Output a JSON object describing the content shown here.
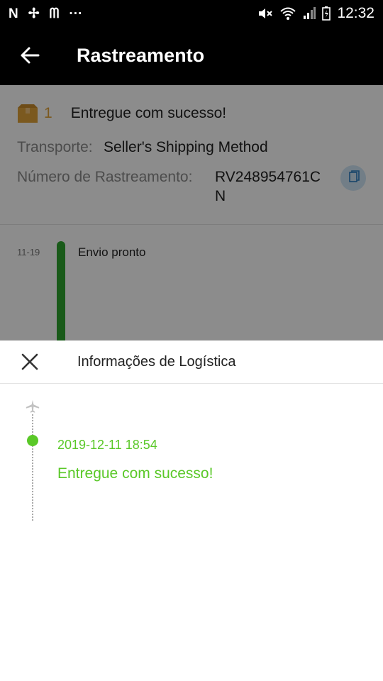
{
  "status_bar": {
    "left_icons": [
      "N",
      "✢",
      "ᗰ",
      "···"
    ],
    "time": "12:32"
  },
  "app_bar": {
    "title": "Rastreamento"
  },
  "order": {
    "count": "1",
    "status": "Entregue com sucesso!",
    "transport_label": "Transporte:",
    "transport_value": "Seller's Shipping Method",
    "tracking_label": "Número de Rastreamento:",
    "tracking_value_line1": "RV248954761C",
    "tracking_value_line2": "N"
  },
  "timeline": {
    "date": "11-19",
    "event": "Envio pronto"
  },
  "sheet": {
    "title": "Informações de Logística",
    "event_time": "2019-12-11 18:54",
    "event_text": "Entregue com sucesso!"
  },
  "colors": {
    "accent_green": "#5ac828",
    "timeline_green": "#2ea52e",
    "box_color": "#e0a23a"
  }
}
